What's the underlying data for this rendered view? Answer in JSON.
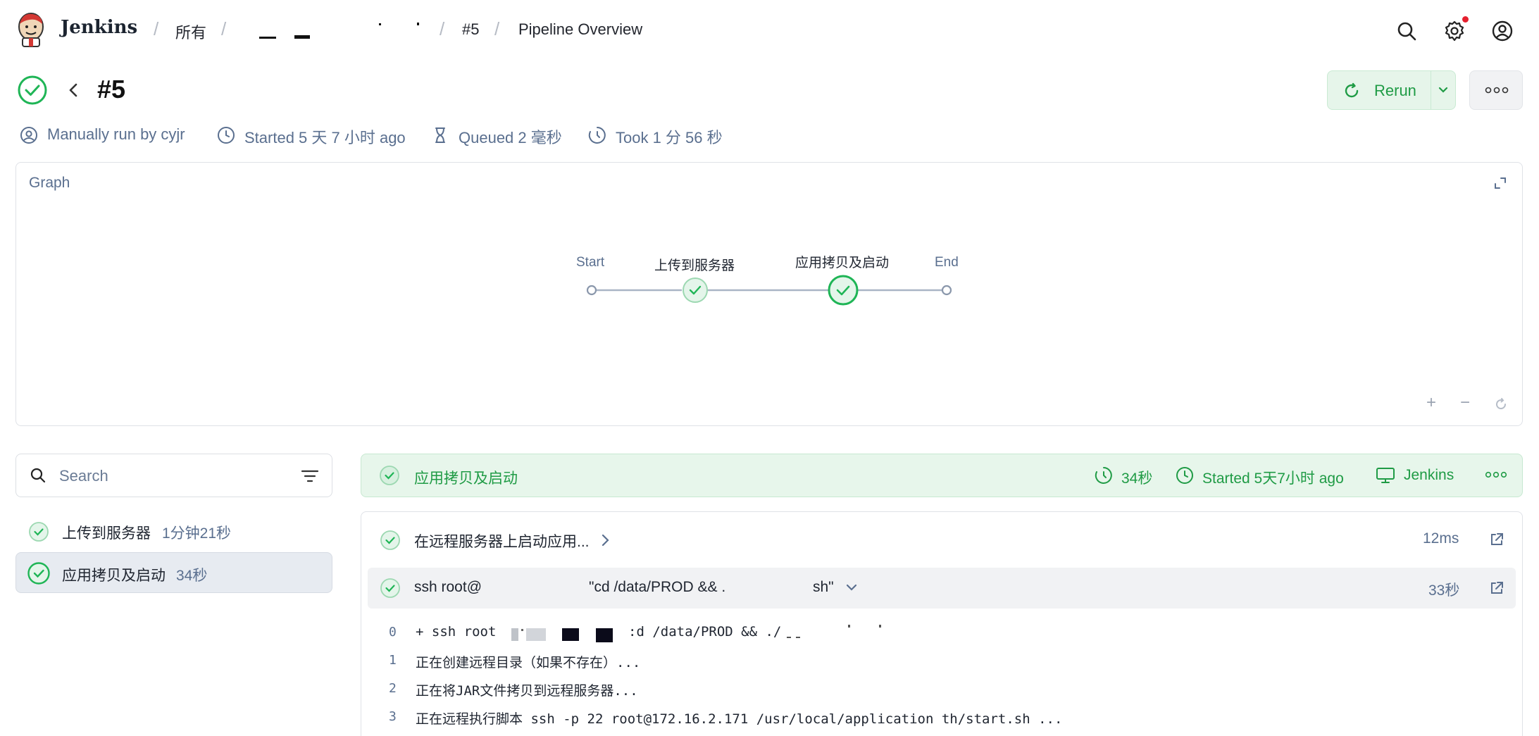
{
  "header": {
    "brand": "Jenkins",
    "breadcrumbs": [
      "所有",
      "#5",
      "Pipeline Overview"
    ]
  },
  "run": {
    "title": "#5",
    "rerun_label": "Rerun",
    "manual": "Manually run by cyjr",
    "started": "Started 5 天 7 小时 ago",
    "queued": "Queued 2 毫秒",
    "took": "Took 1 分 56 秒"
  },
  "graph": {
    "title": "Graph",
    "nodes": [
      "Start",
      "上传到服务器",
      "应用拷贝及启动",
      "End"
    ]
  },
  "sidebar": {
    "search_placeholder": "Search",
    "stages": [
      {
        "name": "上传到服务器",
        "duration": "1分钟21秒"
      },
      {
        "name": "应用拷贝及启动",
        "duration": "34秒"
      }
    ]
  },
  "stage_detail": {
    "name": "应用拷贝及启动",
    "duration": "34秒",
    "started": "Started 5天7小时 ago",
    "agent": "Jenkins",
    "steps": [
      {
        "label": "在远程服务器上启动应用...",
        "duration": "12ms"
      },
      {
        "label_a": "ssh root@",
        "label_b": "\"cd /data/PROD && .",
        "label_c": "sh\"",
        "duration": "33秒"
      }
    ]
  },
  "log": {
    "line_numbers": [
      "0",
      "1",
      "2",
      "3"
    ],
    "lines": [
      "+ ssh root",
      "正在创建远程目录（如果不存在）...",
      "正在将JAR文件拷贝到远程服务器...",
      "正在远程执行脚本 ssh -p 22 root@172.16.2.171 /usr/local/application        th/start.sh ..."
    ],
    "line0_tail": ":d /data/PROD && ./"
  },
  "colors": {
    "success": "#1fb556",
    "success_text": "#1f9b45",
    "muted": "#5a6f8f"
  }
}
